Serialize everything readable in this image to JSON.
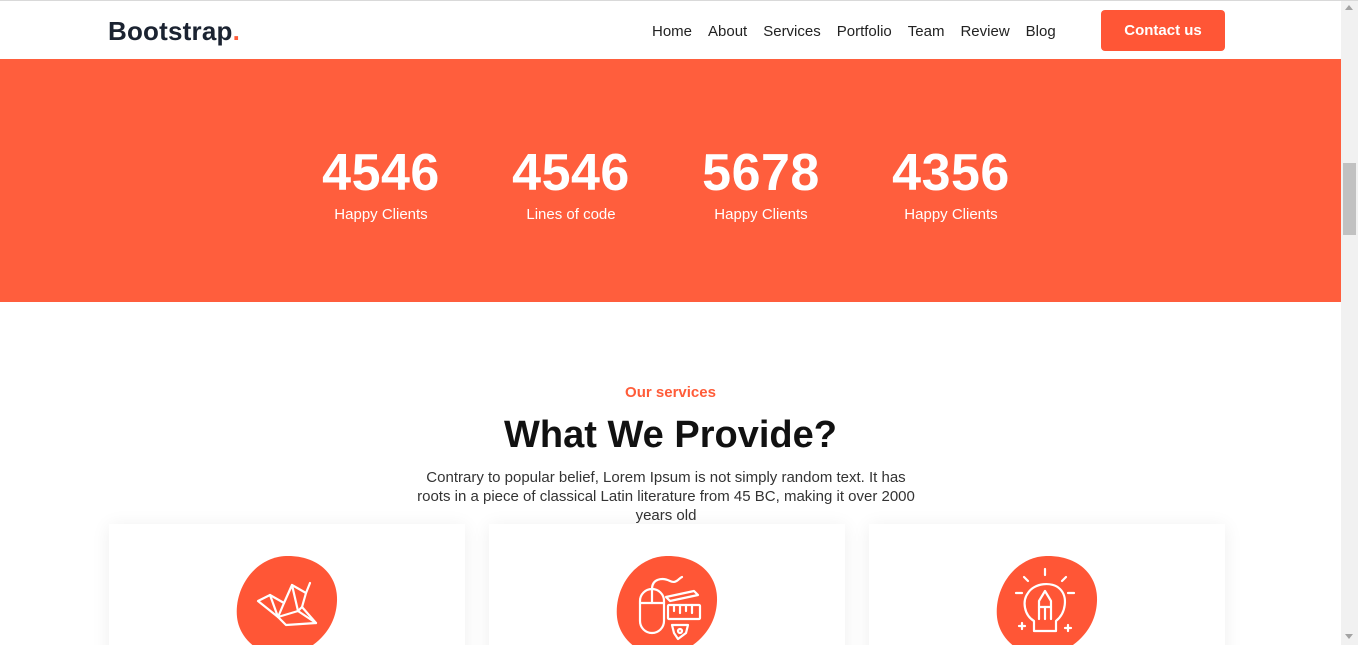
{
  "navbar": {
    "brand": "Bootstrap",
    "brand_dot": ".",
    "links": [
      "Home",
      "About",
      "Services",
      "Portfolio",
      "Team",
      "Review",
      "Blog"
    ],
    "contact_label": "Contact us"
  },
  "stats": [
    {
      "value": "4546",
      "label": "Happy Clients"
    },
    {
      "value": "4546",
      "label": "Lines of code"
    },
    {
      "value": "5678",
      "label": "Happy Clients"
    },
    {
      "value": "4356",
      "label": "Happy Clients"
    }
  ],
  "services": {
    "eyebrow": "Our services",
    "heading": "What We Provide?",
    "description": "Contrary to popular belief, Lorem Ipsum is not simply random text. It has roots in a piece of classical Latin literature from 45 BC, making it over 2000 years old",
    "cards": [
      {
        "icon": "origami-crane-icon"
      },
      {
        "icon": "mouse-design-tools-icon"
      },
      {
        "icon": "lightbulb-pencil-icon"
      }
    ]
  },
  "colors": {
    "accent": "#ff5e3d",
    "button": "#ff5636",
    "brand_text": "#1b2331"
  }
}
